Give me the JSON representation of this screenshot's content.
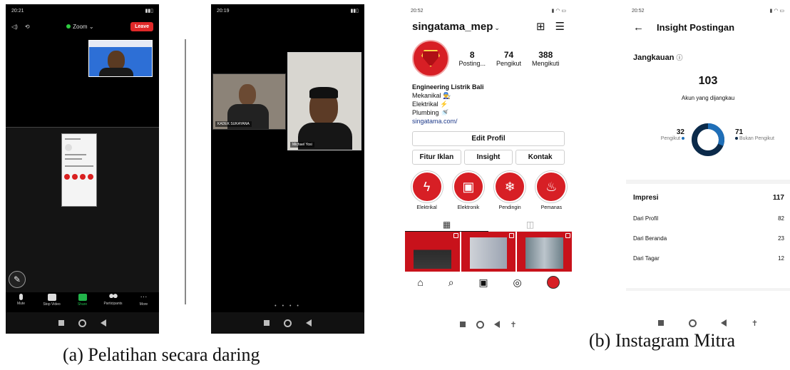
{
  "figure": {
    "caption_a": "(a) Pelatihan secara daring",
    "caption_b": "(b) Instagram Mitra"
  },
  "zoom_phone_1": {
    "status_time": "20:21",
    "meeting_name": "Zoom",
    "leave_label": "Leave",
    "toolbar": [
      {
        "label": "Mute",
        "icon": "mic-icon"
      },
      {
        "label": "Stop Video",
        "icon": "video-camera-icon"
      },
      {
        "label": "Share",
        "icon": "share-screen-icon"
      },
      {
        "label": "Participants",
        "icon": "participants-icon"
      },
      {
        "label": "More",
        "icon": "more-dots-icon"
      }
    ]
  },
  "zoom_phone_2": {
    "status_time": "20:19",
    "participants": [
      {
        "name": "KADEK SUKAYANA"
      },
      {
        "name": "Michael Yosi"
      }
    ],
    "page_dots": "• • • •"
  },
  "instagram_profile": {
    "status_time": "20:52",
    "username": "singatama_mep",
    "stats": [
      {
        "value": "8",
        "label": "Posting..."
      },
      {
        "value": "74",
        "label": "Pengikut"
      },
      {
        "value": "388",
        "label": "Mengikuti"
      }
    ],
    "bio": {
      "name": "Engineering Listrik Bali",
      "lines": [
        "Mekanikal 👨‍🔧",
        "Elektrikal ⚡",
        "Plumbing 🚿"
      ],
      "link": "singatama.com/"
    },
    "edit_profile_label": "Edit Profil",
    "buttons": [
      "Fitur Iklan",
      "Insight",
      "Kontak"
    ],
    "highlights": [
      {
        "label": "Elektrikal",
        "icon": "lightning-icon"
      },
      {
        "label": "Elektronik",
        "icon": "chip-icon"
      },
      {
        "label": "Pendingin",
        "icon": "snowflake-icon"
      },
      {
        "label": "Pemanas",
        "icon": "flame-icon"
      }
    ],
    "colors": {
      "brand_red": "#d71f25"
    }
  },
  "instagram_insight": {
    "status_time": "20:52",
    "title": "Insight Postingan",
    "reach_section": "Jangkauan",
    "reach_value": "103",
    "reach_label": "Akun yang dijangkau",
    "followers": {
      "value": "32",
      "label": "Pengikut"
    },
    "non_followers": {
      "value": "71",
      "label": "Bukan Pengikut"
    },
    "donut_colors": {
      "followers": "#1f6fb8",
      "non_followers": "#0b2a4a"
    },
    "impressions": {
      "label": "Impresi",
      "value": "117",
      "rows": [
        {
          "label": "Dari Profil",
          "value": "82"
        },
        {
          "label": "Dari Beranda",
          "value": "23"
        },
        {
          "label": "Dari Tagar",
          "value": "12"
        }
      ]
    }
  }
}
